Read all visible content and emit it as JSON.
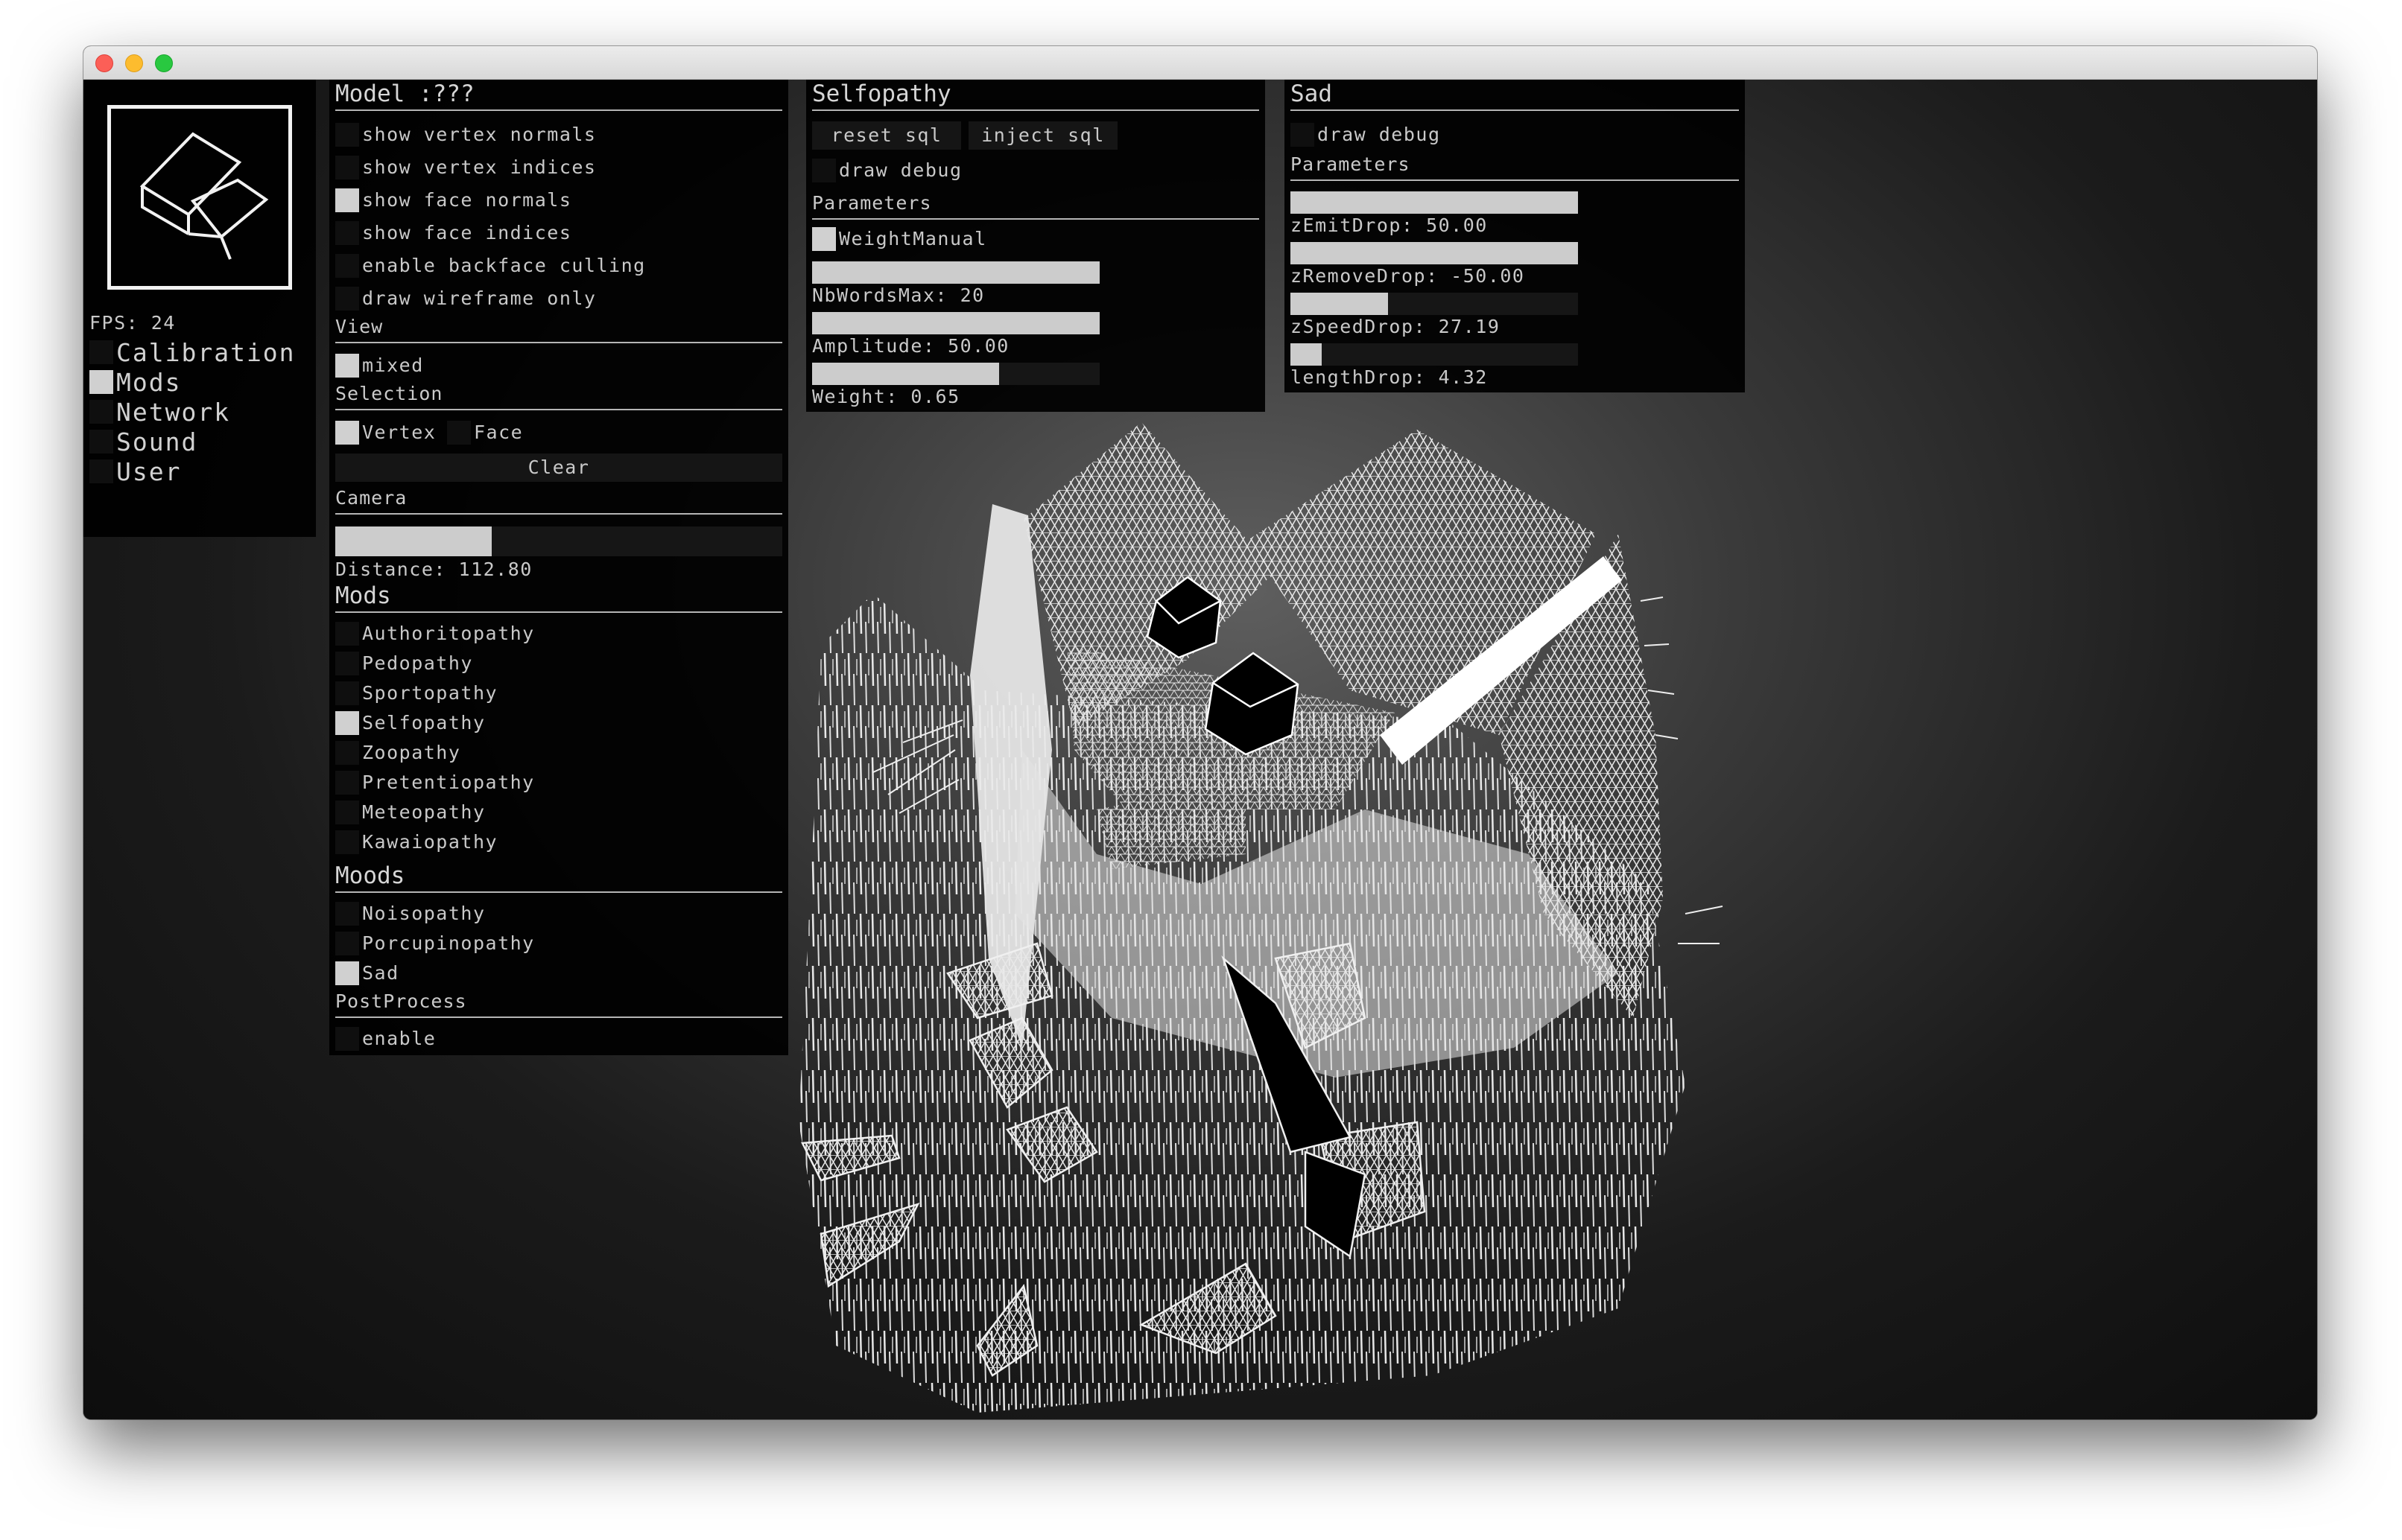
{
  "window": {
    "traffic_lights": [
      "close",
      "minimize",
      "maximize"
    ]
  },
  "sidebar": {
    "fps": "FPS: 24",
    "menu": [
      {
        "label": "Calibration",
        "checked": false
      },
      {
        "label": "Mods",
        "checked": true
      },
      {
        "label": "Network",
        "checked": false
      },
      {
        "label": "Sound",
        "checked": false
      },
      {
        "label": "User",
        "checked": false
      }
    ]
  },
  "model_panel": {
    "title": "Model :???",
    "options": [
      {
        "label": "show vertex normals",
        "checked": false
      },
      {
        "label": "show vertex indices",
        "checked": false
      },
      {
        "label": "show face normals",
        "checked": true
      },
      {
        "label": "show face indices",
        "checked": false
      },
      {
        "label": "enable backface culling",
        "checked": false
      },
      {
        "label": "draw wireframe only",
        "checked": false
      }
    ],
    "view": {
      "label": "View",
      "mixed": {
        "label": "mixed",
        "checked": true
      }
    },
    "selection": {
      "label": "Selection",
      "vertex": {
        "label": "Vertex",
        "checked": true
      },
      "face": {
        "label": "Face",
        "checked": false
      },
      "clear": "Clear"
    },
    "camera": {
      "label": "Camera",
      "distance": 112.8,
      "distance_fraction": 0.35,
      "distance_label": "Distance: 112.80"
    },
    "mods": {
      "label": "Mods",
      "items": [
        {
          "label": "Authoritopathy",
          "checked": false
        },
        {
          "label": "Pedopathy",
          "checked": false
        },
        {
          "label": "Sportopathy",
          "checked": false
        },
        {
          "label": "Selfopathy",
          "checked": true
        },
        {
          "label": "Zoopathy",
          "checked": false
        },
        {
          "label": "Pretentiopathy",
          "checked": false
        },
        {
          "label": "Meteopathy",
          "checked": false
        },
        {
          "label": "Kawaiopathy",
          "checked": false
        }
      ]
    },
    "moods": {
      "label": "Moods",
      "items": [
        {
          "label": "Noisopathy",
          "checked": false
        },
        {
          "label": "Porcupinopathy",
          "checked": false
        },
        {
          "label": "Sad",
          "checked": true
        }
      ]
    },
    "postprocess": {
      "label": "PostProcess",
      "enable": {
        "label": "enable",
        "checked": false
      }
    }
  },
  "selfopathy_panel": {
    "title": "Selfopathy",
    "reset_sql": "reset sql",
    "inject_sql": "inject sql",
    "draw_debug": {
      "label": "draw debug",
      "checked": false
    },
    "parameters_label": "Parameters",
    "weight_manual": {
      "label": "WeightManual",
      "checked": true
    },
    "sliders": [
      {
        "label": "NbWordsMax: 20",
        "value": 20,
        "fraction": 1.0
      },
      {
        "label": "Amplitude: 50.00",
        "value": 50.0,
        "fraction": 1.0
      },
      {
        "label": "Weight: 0.65",
        "value": 0.65,
        "fraction": 0.65
      }
    ]
  },
  "sad_panel": {
    "title": "Sad",
    "draw_debug": {
      "label": "draw debug",
      "checked": false
    },
    "parameters_label": "Parameters",
    "sliders": [
      {
        "label": "zEmitDrop: 50.00",
        "value": 50.0,
        "fraction": 1.0
      },
      {
        "label": "zRemoveDrop: -50.00",
        "value": -50.0,
        "fraction": 1.0
      },
      {
        "label": "zSpeedDrop: 27.19",
        "value": 27.19,
        "fraction": 0.34
      },
      {
        "label": "lengthDrop: 4.32",
        "value": 4.32,
        "fraction": 0.11
      }
    ]
  },
  "colors": {
    "panel_bg": "#000000",
    "text": "#c9c9c9",
    "checked": "#d0d0d0",
    "slider_fill": "#cccccc"
  }
}
